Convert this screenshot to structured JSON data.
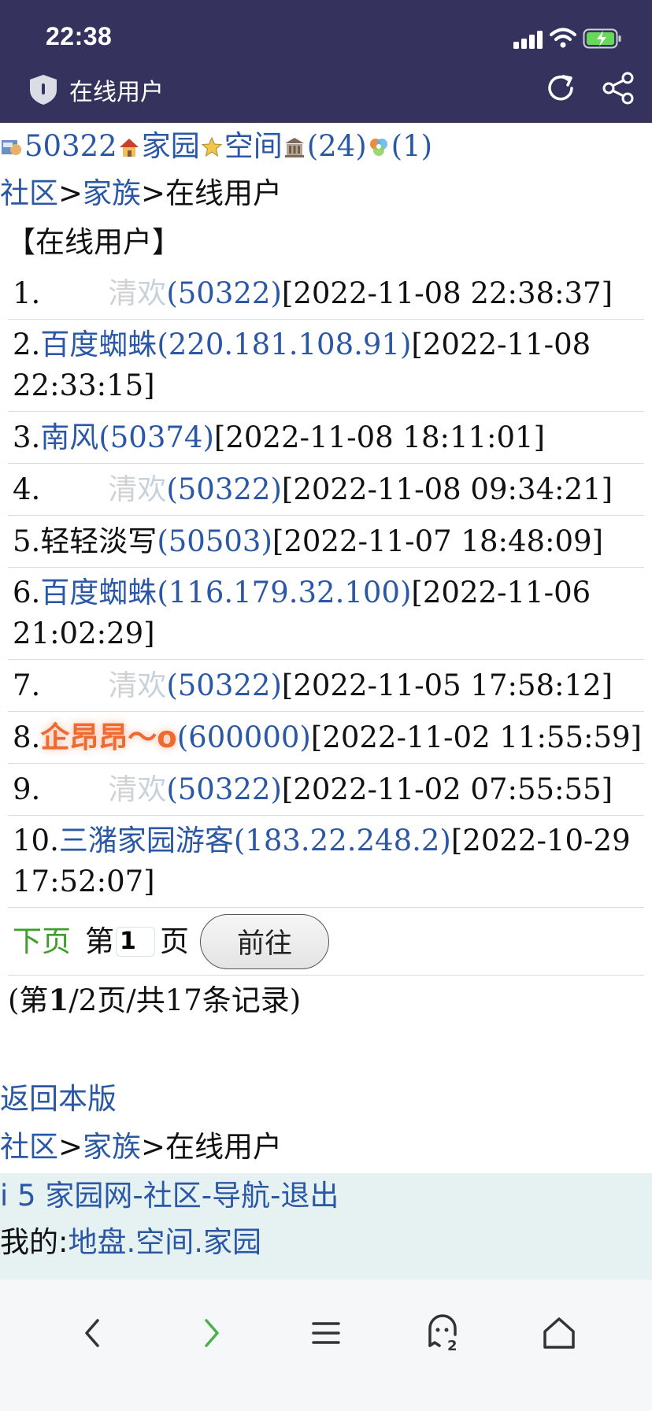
{
  "status_bar": {
    "time": "22:38"
  },
  "browser": {
    "title": "在线用户"
  },
  "top_links": {
    "id": "50322",
    "home": "家园",
    "space": "空间",
    "count1": "(24)",
    "count2": "(1)"
  },
  "breadcrumb": {
    "community": "社区",
    "sep": ">",
    "family": "家族",
    "current": "在线用户"
  },
  "section_title": "【在线用户】",
  "rows": [
    {
      "num": "1.",
      "name": "清欢",
      "uid": "(50322)",
      "time": "[2022-11-08 22:38:37]"
    },
    {
      "num": "2.",
      "name": "百度蜘蛛",
      "uid": "(220.181.108.91)",
      "time": "[2022-11-08 22:33:15]"
    },
    {
      "num": "3.",
      "name": "南风",
      "uid": "(50374)",
      "time": "[2022-11-08 18:11:01]"
    },
    {
      "num": "4.",
      "name": "清欢",
      "uid": "(50322)",
      "time": "[2022-11-08 09:34:21]"
    },
    {
      "num": "5.",
      "name": "轻轻淡写",
      "uid": "(50503)",
      "time": "[2022-11-07 18:48:09]"
    },
    {
      "num": "6.",
      "name": "百度蜘蛛",
      "uid": "(116.179.32.100)",
      "time": "[2022-11-06 21:02:29]"
    },
    {
      "num": "7.",
      "name": "清欢",
      "uid": "(50322)",
      "time": "[2022-11-05 17:58:12]"
    },
    {
      "num": "8.",
      "name": "企昂昂～o",
      "uid": "(600000)",
      "time": "[2022-11-02 11:55:59]"
    },
    {
      "num": "9.",
      "name": "清欢",
      "uid": "(50322)",
      "time": "[2022-11-02 07:55:55]"
    },
    {
      "num": "10.",
      "name": "三潴家园游客",
      "uid": "(183.22.248.2)",
      "time": "[2022-10-29 17:52:07]"
    }
  ],
  "pager": {
    "next": "下页",
    "prefix": "第",
    "page_value": "1",
    "suffix": "页",
    "go": "前往"
  },
  "page_info": {
    "open": "(第",
    "current": "1",
    "rest": "/2页/共17条记录)"
  },
  "return_link": "返回本版",
  "footer": {
    "site": "i 5 家园网",
    "community": "社区",
    "nav": "导航",
    "logout": "退出",
    "dash": "-",
    "mine": "我的:",
    "land": "地盘",
    "space": "空间",
    "home": "家园",
    "dot": "."
  },
  "colors": {
    "header_bg": "#35335e",
    "link": "#2b58a6",
    "next_page": "#3e9e2a",
    "footer_bg": "#e6f1f1",
    "divider": "#cfe3dc"
  },
  "icons": [
    "shield-icon",
    "reload-icon",
    "share-icon",
    "back-icon",
    "forward-icon",
    "menu-icon",
    "tabs-icon",
    "home-icon"
  ]
}
